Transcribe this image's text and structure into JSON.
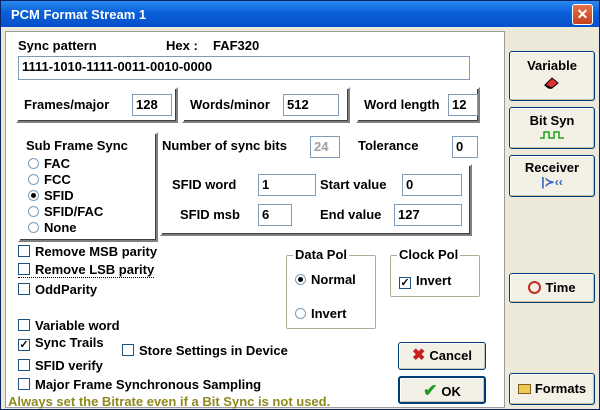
{
  "window": {
    "title": "PCM Format Stream 1",
    "close_glyph": "✕"
  },
  "sync": {
    "label": "Sync pattern",
    "hex_label": "Hex :",
    "hex_value": "FAF320",
    "pattern": "1111-1010-1111-0011-0010-0000"
  },
  "frames": {
    "frames_major_label": "Frames/major",
    "frames_major": "128",
    "words_minor_label": "Words/minor",
    "words_minor": "512",
    "word_length_label": "Word length",
    "word_length": "12"
  },
  "subframe": {
    "label": "Sub Frame Sync",
    "options": [
      "FAC",
      "FCC",
      "SFID",
      "SFID/FAC",
      "None"
    ],
    "selected": "SFID"
  },
  "sync_bits": {
    "label": "Number of sync bits",
    "value": "24",
    "tolerance_label": "Tolerance",
    "tolerance": "0"
  },
  "sfid": {
    "word_label": "SFID word",
    "word": "1",
    "msb_label": "SFID msb",
    "msb": "6",
    "start_label": "Start value",
    "start": "0",
    "end_label": "End value",
    "end": "127"
  },
  "parity": {
    "remove_msb": "Remove MSB parity",
    "remove_lsb": "Remove LSB parity",
    "odd": "OddParity"
  },
  "data_pol": {
    "label": "Data Pol",
    "normal": "Normal",
    "invert": "Invert",
    "selected": "Normal"
  },
  "clock_pol": {
    "label": "Clock Pol",
    "invert": "Invert",
    "invert_checked": true
  },
  "options": {
    "variable_word": "Variable word",
    "sync_trails": "Sync Trails",
    "sfid_verify": "SFID verify",
    "store_settings": "Store Settings in Device",
    "major_frame_sync": "Major Frame Synchronous Sampling",
    "check_glyph": "✓"
  },
  "hint": "Always set the Bitrate even if a Bit Sync is not used.",
  "buttons": {
    "variable": "Variable",
    "bit_syn": "Bit Syn",
    "receiver": "Receiver",
    "time": "Time",
    "cancel": "Cancel",
    "ok": "OK",
    "formats": "Formats"
  },
  "icons": {
    "variable": "eraser-icon",
    "bit_syn": "square-wave-icon",
    "receiver": "signal-receiver-icon",
    "time": "clock-icon",
    "cancel": "x-icon",
    "ok": "checkmark-icon",
    "formats": "folder-icon"
  },
  "colors": {
    "title_bar": "#0a5fd8",
    "hint_text": "#8e8a1e",
    "cancel_x": "#c81e1e",
    "ok_check": "#1f9a1f",
    "bit_syn_wave": "#1fa01f"
  }
}
